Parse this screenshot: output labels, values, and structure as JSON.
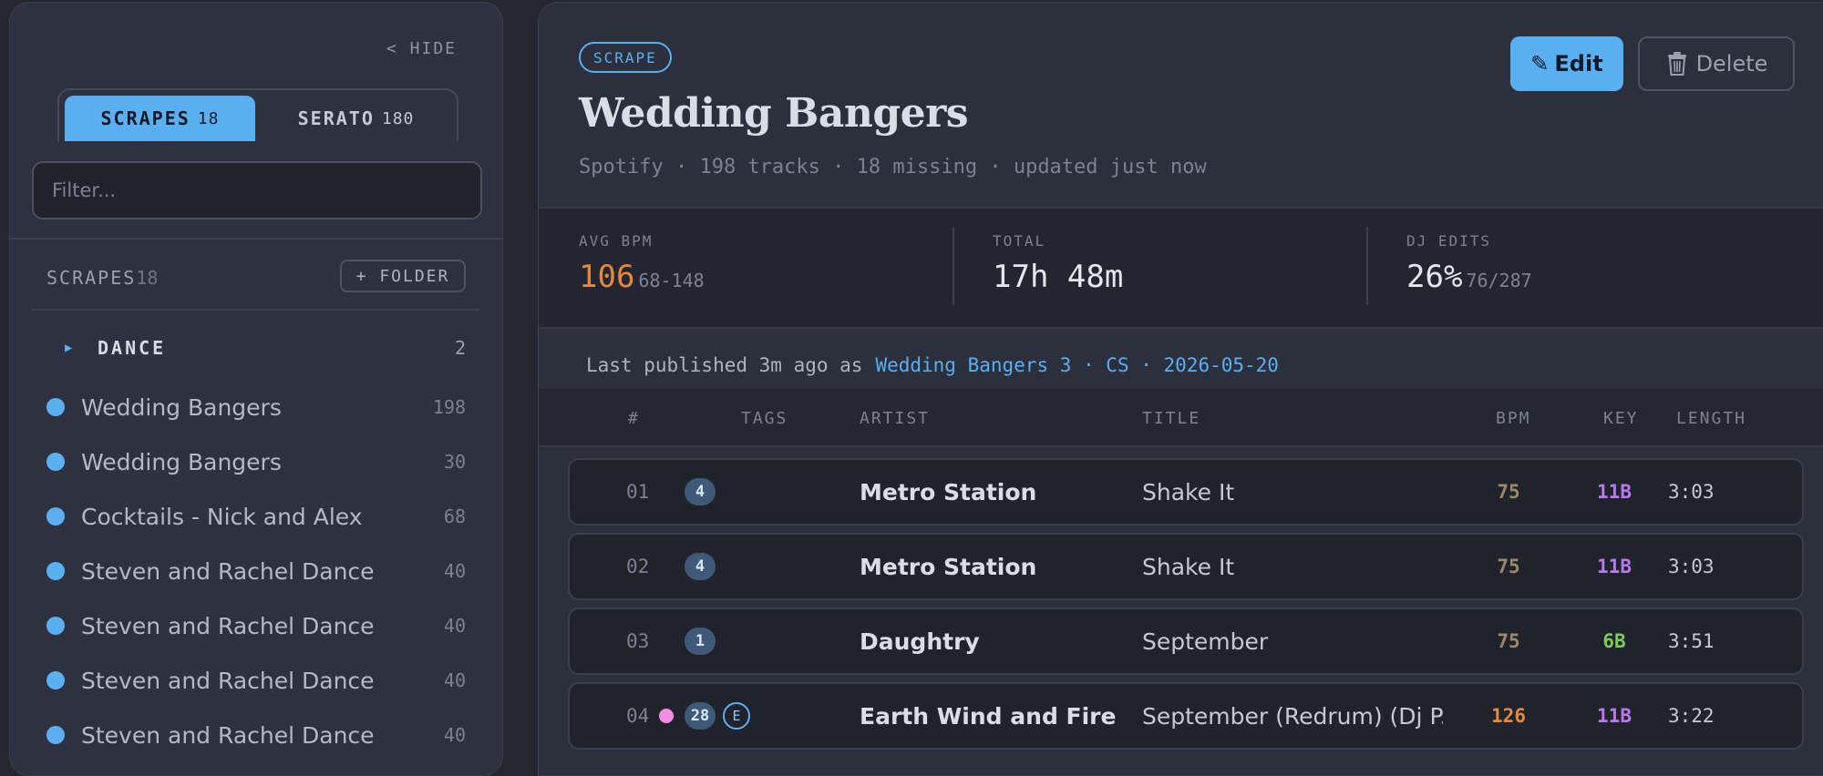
{
  "sidebar": {
    "hide_label": "< HIDE",
    "tabs": [
      {
        "label": "SCRAPES",
        "count": "18",
        "active": true
      },
      {
        "label": "SERATO",
        "count": "180",
        "active": false
      }
    ],
    "filter_placeholder": "Filter...",
    "section_label": "SCRAPES",
    "section_count": "18",
    "folder_button": "+ FOLDER",
    "folder": {
      "name": "DANCE",
      "count": "2"
    },
    "items": [
      {
        "name": "Wedding Bangers",
        "count": "198"
      },
      {
        "name": "Wedding Bangers",
        "count": "30"
      },
      {
        "name": "Cocktails - Nick and Alex",
        "count": "68"
      },
      {
        "name": "Steven and Rachel Dance",
        "count": "40"
      },
      {
        "name": "Steven and Rachel Dance",
        "count": "40"
      },
      {
        "name": "Steven and Rachel Dance",
        "count": "40"
      },
      {
        "name": "Steven and Rachel Dance",
        "count": "40"
      }
    ]
  },
  "header": {
    "badge": "SCRAPE",
    "title": "Wedding Bangers",
    "subtitle": "Spotify · 198 tracks · 18 missing · updated just now",
    "edit_label": "Edit",
    "delete_label": "Delete"
  },
  "stats": [
    {
      "label": "AVG BPM",
      "value": "106",
      "sub": "68-148"
    },
    {
      "label": "TOTAL",
      "value": "17h 48m",
      "sub": ""
    },
    {
      "label": "DJ EDITS",
      "value": "26%",
      "sub": "76/287"
    }
  ],
  "publish": {
    "text": "Last published 3m ago as",
    "link": "Wedding Bangers 3 · CS · 2026-05-20"
  },
  "table": {
    "columns": [
      "#",
      "TAGS",
      "ARTIST",
      "TITLE",
      "BPM",
      "KEY",
      "LENGTH"
    ],
    "rows": [
      {
        "num": "01",
        "tag": "4",
        "artist": "Metro Station",
        "title": "Shake It",
        "bpm": "75",
        "key": "11B",
        "length": "3:03"
      },
      {
        "num": "02",
        "tag": "4",
        "artist": "Metro Station",
        "title": "Shake It",
        "bpm": "75",
        "key": "11B",
        "length": "3:03"
      },
      {
        "num": "03",
        "tag": "1",
        "artist": "Daughtry",
        "title": "September",
        "bpm": "75",
        "key": "6B",
        "length": "3:51"
      },
      {
        "num": "04",
        "tag": "28",
        "tag_extra": "E",
        "artist": "Earth Wind and Fire",
        "title": "September (Redrum) (Dj P...",
        "bpm": "126",
        "key": "11B",
        "length": "3:22"
      }
    ]
  },
  "colors": {
    "accent": "#5aaff1",
    "bpm_low": "#9a8a6a",
    "bpm_high": "#e2893f",
    "key_purple": "#b67be8",
    "key_green": "#7dc95a",
    "tag_dot_pink": "#f28ee4"
  }
}
